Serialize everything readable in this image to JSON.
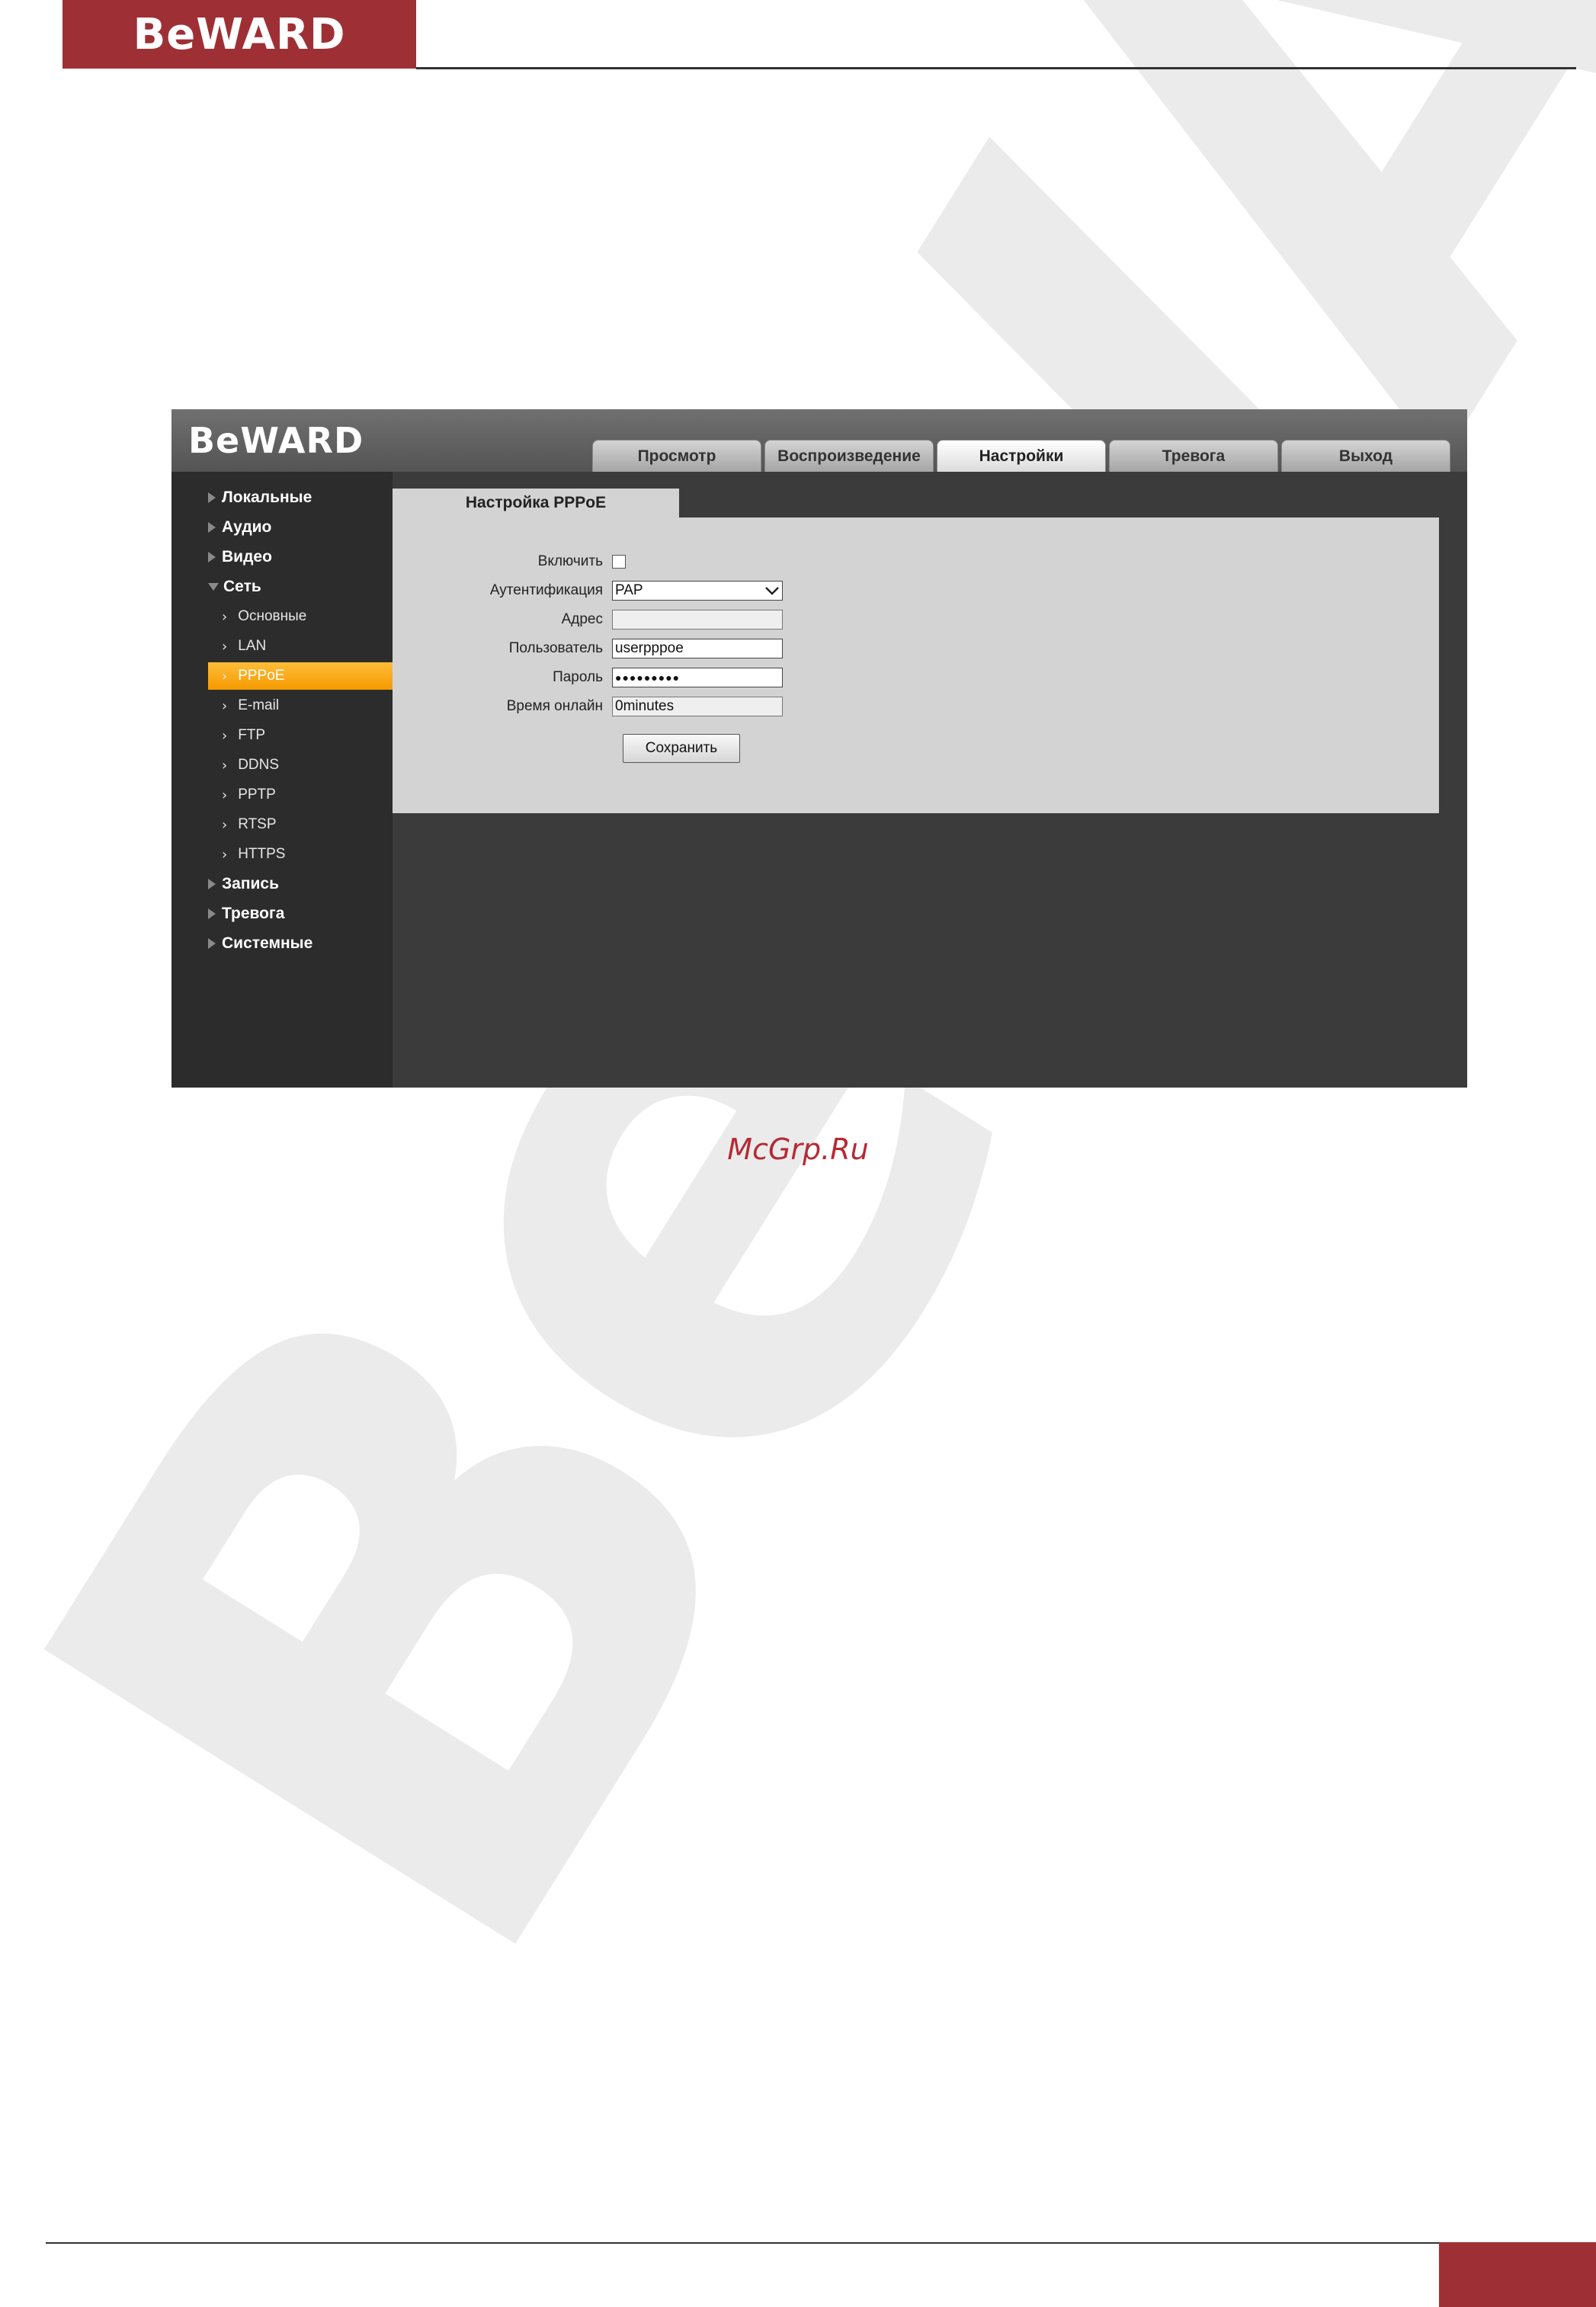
{
  "document": {
    "logo_text": "BeWARD",
    "source_link": "McGrp.Ru",
    "watermark_text": "BeWARD"
  },
  "app": {
    "logo_text": "BeWARD",
    "tabs": [
      {
        "label": "Просмотр",
        "active": false
      },
      {
        "label": "Воспроизведение",
        "active": false
      },
      {
        "label": "Настройки",
        "active": true
      },
      {
        "label": "Тревога",
        "active": false
      },
      {
        "label": "Выход",
        "active": false
      }
    ],
    "sidebar": {
      "sections": [
        {
          "label": "Локальные",
          "expanded": false
        },
        {
          "label": "Аудио",
          "expanded": false
        },
        {
          "label": "Видео",
          "expanded": false
        },
        {
          "label": "Сеть",
          "expanded": true
        },
        {
          "label": "Запись",
          "expanded": false
        },
        {
          "label": "Тревога",
          "expanded": false
        },
        {
          "label": "Системные",
          "expanded": false
        }
      ],
      "network_items": [
        "Основные",
        "LAN",
        "PPPoE",
        "E-mail",
        "FTP",
        "DDNS",
        "PPTP",
        "RTSP",
        "HTTPS"
      ],
      "active_item": "PPPoE"
    },
    "content": {
      "tab_title": "Настройка PPPoE",
      "enable": {
        "label": "Включить",
        "checked": false
      },
      "auth": {
        "label": "Аутентификация",
        "value": "PAP"
      },
      "address": {
        "label": "Адрес",
        "value": ""
      },
      "user": {
        "label": "Пользователь",
        "value": "userpppoe"
      },
      "password": {
        "label": "Пароль",
        "value": "●●●●●●●●●"
      },
      "online_time": {
        "label": "Время онлайн",
        "value": "0minutes"
      },
      "save_label": "Сохранить"
    }
  },
  "colors": {
    "brand_red": "#9e3035",
    "active_orange": "#f59a00",
    "app_bg": "#3b3b3b",
    "panel_bg": "#d3d3d3"
  }
}
